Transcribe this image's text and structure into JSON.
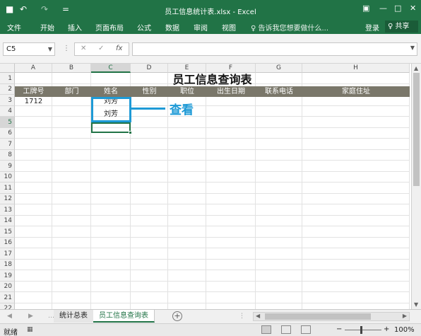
{
  "window": {
    "title": "员工信息统计表.xlsx - Excel",
    "undo_icon": "↶",
    "redo_icon": "↷",
    "qat_more": "="
  },
  "ribbon": {
    "tabs": [
      "文件",
      "开始",
      "插入",
      "页面布局",
      "公式",
      "数据",
      "审阅",
      "视图"
    ],
    "tell_me": "♀ 告诉我您想要做什么...",
    "login": "登录",
    "share": "♀ 共享"
  },
  "formula_bar": {
    "name_box": "C5",
    "cancel": "✕",
    "enter": "✓",
    "fx": "fx",
    "value": ""
  },
  "columns": [
    "A",
    "B",
    "C",
    "D",
    "E",
    "F",
    "G",
    "H"
  ],
  "rows": [
    "1",
    "2",
    "3",
    "4",
    "5",
    "6",
    "7",
    "8",
    "9",
    "10",
    "11",
    "12",
    "13",
    "14",
    "15",
    "16",
    "17",
    "18",
    "19",
    "20",
    "21",
    "22"
  ],
  "sheet": {
    "title": "员工信息查询表",
    "headers": [
      "工牌号",
      "部门",
      "姓名",
      "性别",
      "职位",
      "出生日期",
      "联系电话",
      "家庭住址"
    ],
    "cells": {
      "A3": "1712",
      "C3": "刘芳",
      "C4": "刘芳"
    }
  },
  "annotation": {
    "label": "查看",
    "color": "#1e9ad6"
  },
  "sheet_tabs": [
    "统计总表",
    "员工信息查询表"
  ],
  "active_sheet": "员工信息查询表",
  "status_bar": {
    "ready": "就绪",
    "zoom": "100%",
    "minus": "−",
    "plus": "+"
  },
  "colors": {
    "accent": "#217346",
    "header_band": "#7a776a"
  }
}
